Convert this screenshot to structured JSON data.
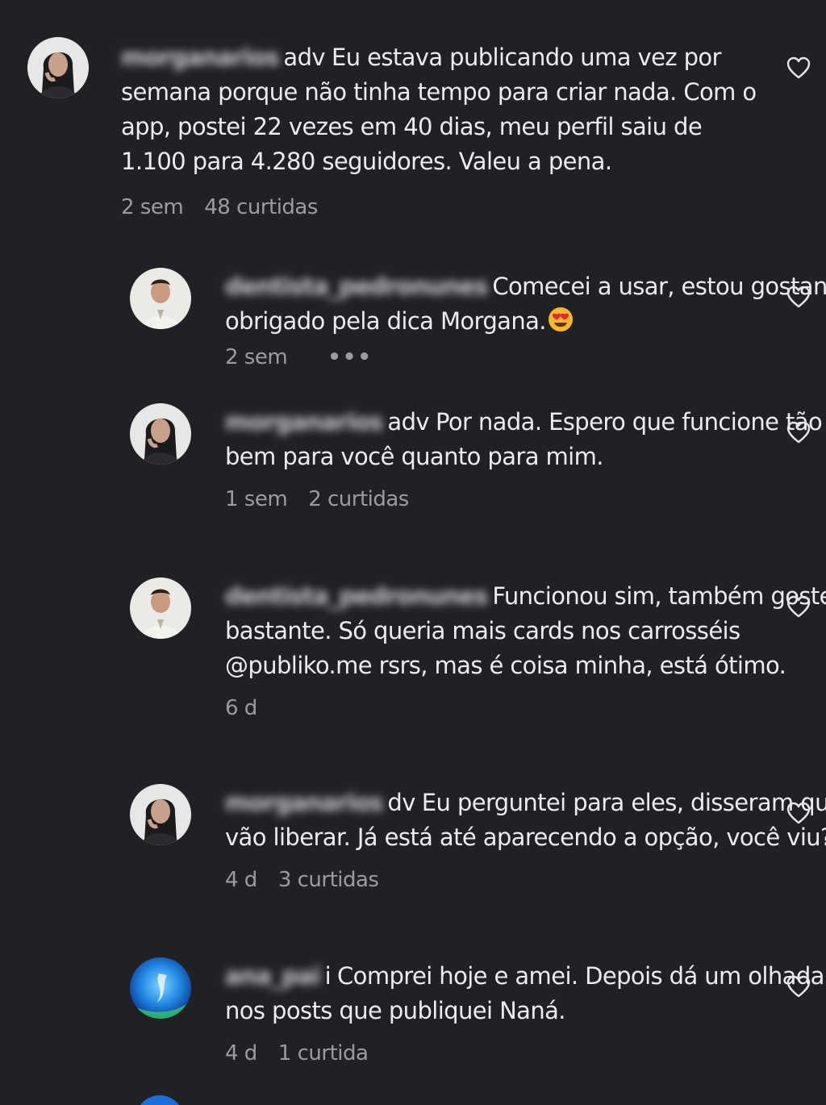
{
  "comments": [
    {
      "username": "morganarios",
      "username_tail": "adv",
      "text": "Eu estava publicando uma vez por semana porque não tinha tempo para criar nada. Com o app, postei 22 vezes em 40 dias, meu perfil saiu de 1.100 para 4.280 seguidores. Valeu a pena.",
      "time": "2 sem",
      "likes": "48 curtidas",
      "avatar_icon": "woman-avatar"
    },
    {
      "username": "dentista_pedronunes",
      "username_tail": "",
      "text": "Comecei a usar, estou gostando. obrigado pela dica Morgana.",
      "emoji": "heart-eyes-emoji",
      "time": "2 sem",
      "more": "•••",
      "avatar_icon": "man-avatar"
    },
    {
      "username": "morganarios",
      "username_tail": "adv",
      "text": "Por nada. Espero que funcione tão bem para você quanto para mim.",
      "time": "1 sem",
      "likes": "2 curtidas",
      "avatar_icon": "woman-avatar"
    },
    {
      "username": "dentista_pedronunes",
      "username_tail": "",
      "text": "Funcionou sim, também gostei bastante. Só queria mais cards nos carrosséis @publiko.me rsrs, mas é coisa minha, está ótimo.",
      "time": "6 d",
      "avatar_icon": "man-avatar"
    },
    {
      "username": "morganarios",
      "username_tail": "dv",
      "text": "Eu perguntei para eles, disseram que vão liberar. Já está até aparecendo a opção, você viu?",
      "time": "4 d",
      "likes": "3 curtidas",
      "avatar_icon": "woman-avatar"
    },
    {
      "username": "ana_pai",
      "username_tail": "i",
      "text": "Comprei hoje e amei. Depois dá um olhada nos posts que publiquei Naná.",
      "time": "4 d",
      "likes": "1 curtida",
      "avatar_icon": "blue-abstract-avatar"
    }
  ],
  "colors": {
    "background": "#202125",
    "text": "#ececee",
    "meta": "#9b9ca1"
  },
  "icons": {
    "like": "heart-outline-icon"
  }
}
